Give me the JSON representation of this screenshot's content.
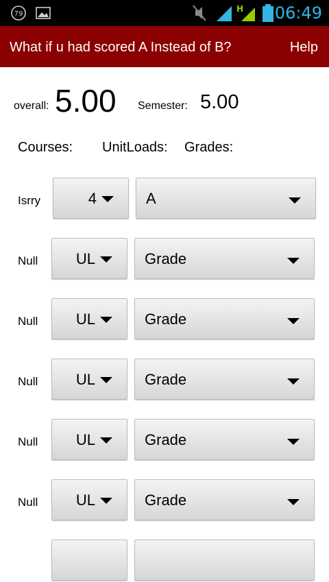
{
  "status_bar": {
    "time": "06:49",
    "notification_badge": "79",
    "time_color": "#33b5e5",
    "network_type": "H",
    "icons": [
      "notification-79-icon",
      "gallery-icon",
      "mute-icon",
      "wifi-icon",
      "signal-icon",
      "battery-icon"
    ]
  },
  "app_bar": {
    "title": "What if u had scored A Instead of B?",
    "help_label": "Help",
    "color": "#8b0000"
  },
  "summary": {
    "overall_label": "overall:",
    "overall_value": "5.00",
    "semester_label": "Semester:",
    "semester_value": "5.00"
  },
  "headers": {
    "courses": "Courses:",
    "unitloads": "UnitLoads:",
    "grades": "Grades:"
  },
  "rows": [
    {
      "course": "Isrry",
      "unit": "4",
      "grade": "A"
    },
    {
      "course": "Null",
      "unit": "UL",
      "grade": "Grade"
    },
    {
      "course": "Null",
      "unit": "UL",
      "grade": "Grade"
    },
    {
      "course": "Null",
      "unit": "UL",
      "grade": "Grade"
    },
    {
      "course": "Null",
      "unit": "UL",
      "grade": "Grade"
    },
    {
      "course": "Null",
      "unit": "UL",
      "grade": "Grade"
    },
    {
      "course": "",
      "unit": "",
      "grade": ""
    }
  ]
}
